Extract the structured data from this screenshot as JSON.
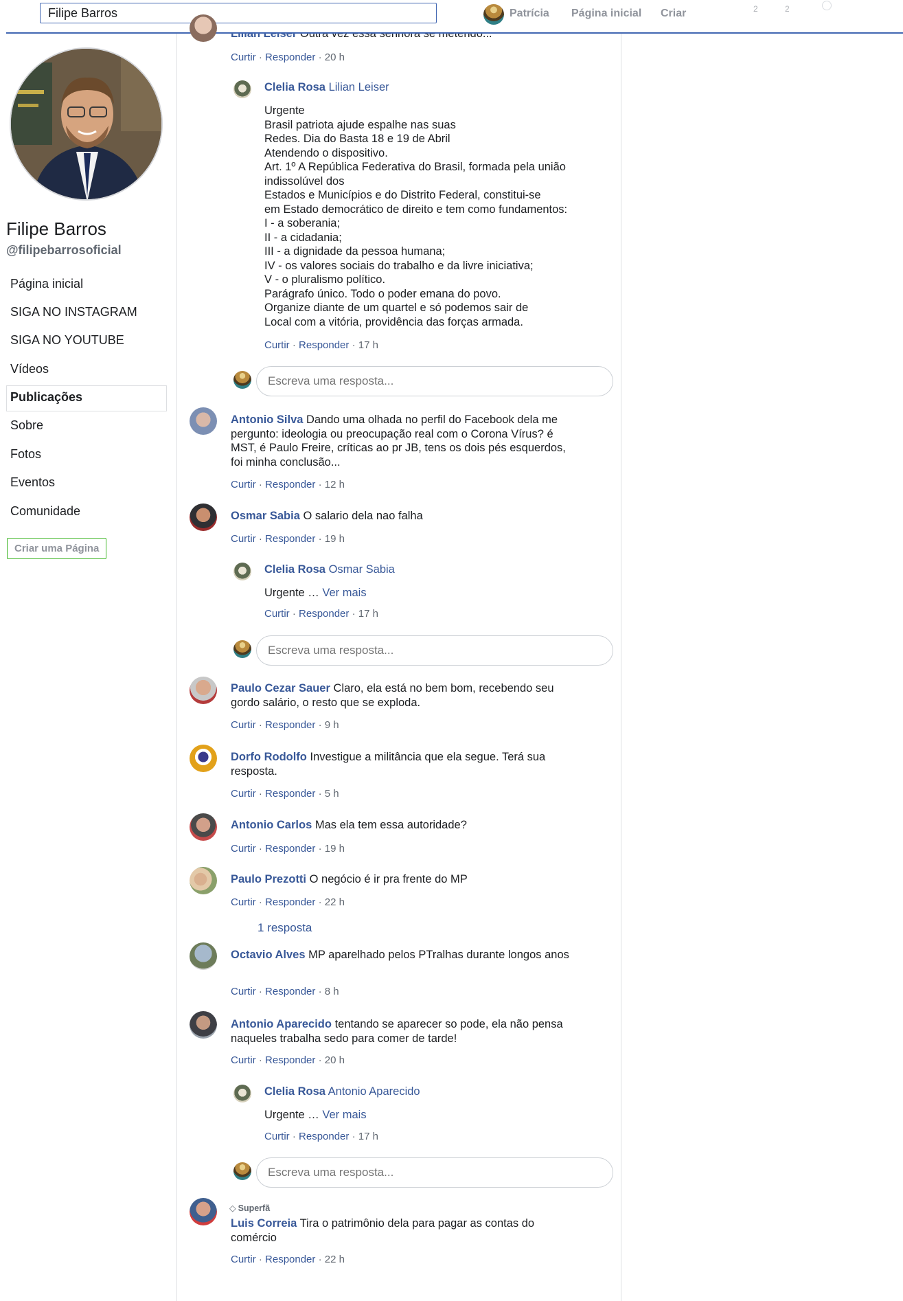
{
  "topbar": {
    "search_value": "Filipe Barros",
    "user_name": "Patrícia",
    "home_label": "Página inicial",
    "create_label": "Criar",
    "friend_requests_count": "2",
    "messages_count": "2"
  },
  "page": {
    "name": "Filipe Barros",
    "handle": "@filipebarrosoficial"
  },
  "left_nav": {
    "items": [
      {
        "label": "Página inicial"
      },
      {
        "label": "SIGA NO INSTAGRAM"
      },
      {
        "label": "SIGA NO YOUTUBE"
      },
      {
        "label": "Vídeos"
      },
      {
        "label": "Publicações"
      },
      {
        "label": "Sobre"
      },
      {
        "label": "Fotos"
      },
      {
        "label": "Eventos"
      },
      {
        "label": "Comunidade"
      }
    ],
    "active_index": 4,
    "create_page_label": "Criar uma Página"
  },
  "ui": {
    "like": "Curtir",
    "reply": "Responder",
    "separator": "·",
    "reply_placeholder": "Escreva uma resposta...",
    "see_more": "Ver mais",
    "superfan_label": "Superfã"
  },
  "comments": {
    "lilian": {
      "author": "Lilian Leiser",
      "text": "Outra vez essa senhora se metendo...",
      "time": "20 h"
    },
    "clelia1": {
      "author": "Clelia Rosa",
      "mention": "Lilian Leiser",
      "lines": [
        "Urgente",
        "Brasil patriota ajude espalhe nas suas",
        "Redes. Dia do Basta 18 e 19 de Abril",
        "Atendendo o dispositivo.",
        "Art. 1º A República Federativa do Brasil, formada pela união indissolúvel dos",
        "Estados e Municípios e do Distrito Federal, constitui-se",
        "em Estado democrático de direito e tem como fundamentos:",
        "I - a soberania;",
        "II - a cidadania;",
        "III - a dignidade da pessoa humana;",
        "IV - os valores sociais do trabalho e da livre iniciativa;",
        "V - o pluralismo político.",
        "Parágrafo único. Todo o poder emana do povo.",
        "Organize diante de um quartel e só podemos sair de",
        "Local com a vitória, providência das forças armada."
      ],
      "time": "17 h"
    },
    "antonio_silva": {
      "author": "Antonio Silva",
      "text": "Dando uma olhada no perfil do Facebook dela me pergunto: ideologia ou preocupação real com o Corona Vírus? é MST, é Paulo Freire, críticas ao pr JB, tens os dois pés esquerdos, foi minha conclusão...",
      "time": "12 h"
    },
    "osmar": {
      "author": "Osmar Sabia",
      "text": "O salario dela nao falha",
      "time": "19 h"
    },
    "clelia2": {
      "author": "Clelia Rosa",
      "mention": "Osmar Sabia",
      "text": "Urgente …",
      "time": "17 h"
    },
    "paulo_cezar": {
      "author": "Paulo Cezar Sauer",
      "text": "Claro, ela está no bem bom, recebendo seu gordo salário, o resto que se exploda.",
      "time": "9 h"
    },
    "dorfo": {
      "author": "Dorfo Rodolfo",
      "text": "Investigue a militância que ela segue. Terá sua resposta.",
      "time": "5 h"
    },
    "antonio_carlos": {
      "author": "Antonio Carlos",
      "text": "Mas ela tem essa autoridade?",
      "time": "19 h"
    },
    "paulo_prezotti": {
      "author": "Paulo Prezotti",
      "text": "O negócio é ir pra frente do MP",
      "time": "22 h",
      "replies_label": "1 resposta"
    },
    "octavio": {
      "author": "Octavio Alves",
      "text": "MP aparelhado pelos PTralhas durante longos anos",
      "time": "8 h"
    },
    "antonio_aparecido": {
      "author": "Antonio Aparecido",
      "text": "tentando se aparecer so pode, ela não pensa naqueles trabalha sedo para comer de tarde!",
      "time": "20 h"
    },
    "clelia3": {
      "author": "Clelia Rosa",
      "mention": "Antonio Aparecido",
      "text": "Urgente …",
      "time": "17 h"
    },
    "luis": {
      "author": "Luis Correia",
      "text": "Tira o patrimônio dela para pagar as contas do comércio",
      "time": "22 h"
    }
  }
}
